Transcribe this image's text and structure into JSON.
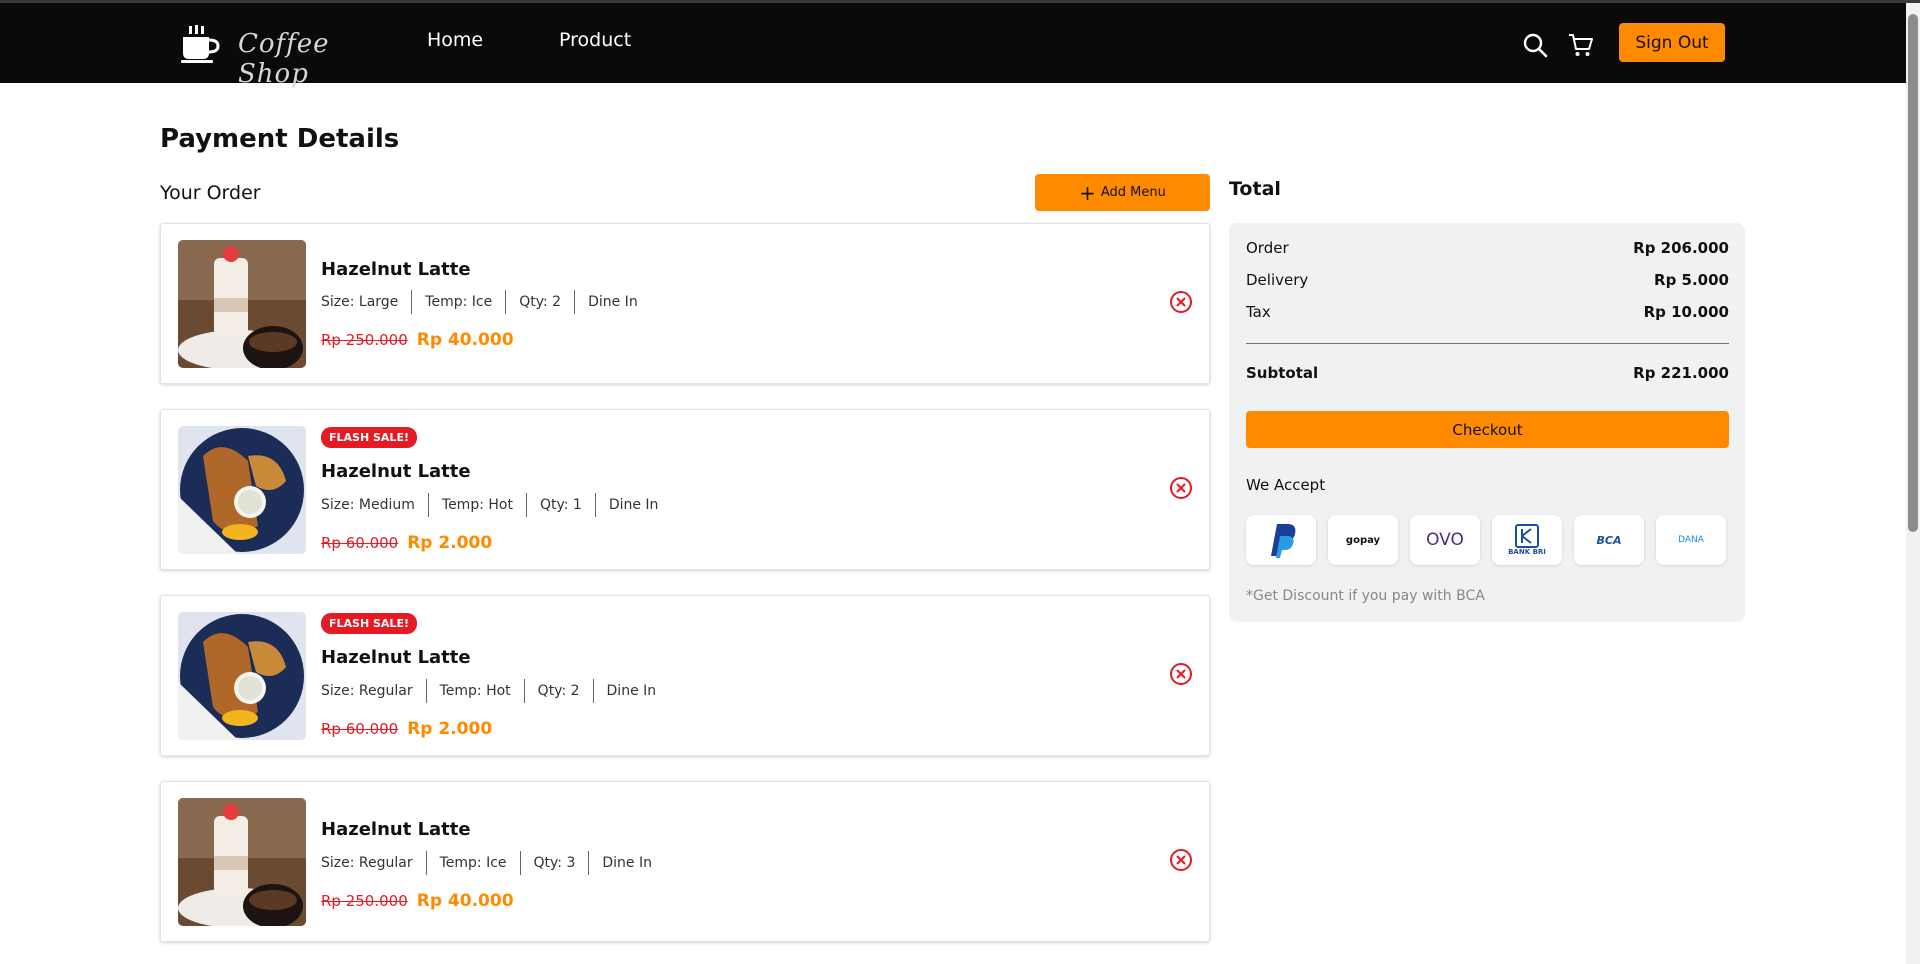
{
  "brand": {
    "name": "Coffee Shop"
  },
  "nav": {
    "links": [
      "Home",
      "Product"
    ],
    "sign_out": "Sign Out",
    "icons": [
      "search-icon",
      "cart-icon"
    ]
  },
  "page": {
    "title": "Payment Details",
    "your_order": "Your Order",
    "add_menu": "Add Menu"
  },
  "orders": [
    {
      "flash": "",
      "name": "Hazelnut Latte",
      "size": "Size: Large",
      "temp": "Temp: Ice",
      "qty": "Qty: 2",
      "dine": "Dine In",
      "old_price": "Rp 250.000",
      "price": "Rp 40.000",
      "image": "latte-icon"
    },
    {
      "flash": "FLASH SALE!",
      "name": "Hazelnut Latte",
      "size": "Size: Medium",
      "temp": "Temp: Hot",
      "qty": "Qty: 1",
      "dine": "Dine In",
      "old_price": "Rp 60.000",
      "price": "Rp 2.000",
      "image": "fried-food-icon"
    },
    {
      "flash": "FLASH SALE!",
      "name": "Hazelnut Latte",
      "size": "Size: Regular",
      "temp": "Temp: Hot",
      "qty": "Qty: 2",
      "dine": "Dine In",
      "old_price": "Rp 60.000",
      "price": "Rp 2.000",
      "image": "fried-food-icon"
    },
    {
      "flash": "",
      "name": "Hazelnut Latte",
      "size": "Size: Regular",
      "temp": "Temp: Ice",
      "qty": "Qty: 3",
      "dine": "Dine In",
      "old_price": "Rp 250.000",
      "price": "Rp 40.000",
      "image": "latte-icon"
    }
  ],
  "total": {
    "title": "Total",
    "order_label": "Order",
    "order_value": "Rp 206.000",
    "delivery_label": "Delivery",
    "delivery_value": "Rp 5.000",
    "tax_label": "Tax",
    "tax_value": "Rp 10.000",
    "subtotal_label": "Subtotal",
    "subtotal_value": "Rp 221.000",
    "checkout": "Checkout",
    "we_accept": "We Accept",
    "payment_methods": [
      "PayPal",
      "gopay",
      "OVO",
      "BANK BRI",
      "BCA",
      "DANA"
    ],
    "discount_note": "*Get Discount if you pay with BCA"
  },
  "colors": {
    "accent": "#ff8a00",
    "danger": "#e51b23",
    "nav_bg": "#0b0909",
    "panel_bg": "#f0f1f3"
  }
}
